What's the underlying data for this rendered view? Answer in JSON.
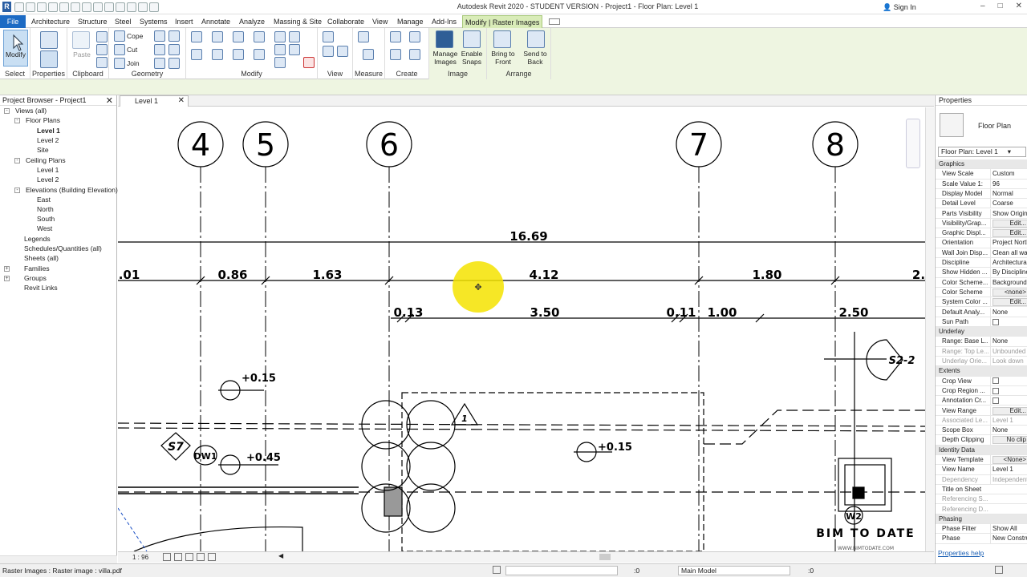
{
  "titlebar": {
    "title": "Autodesk Revit 2020 - STUDENT VERSION - Project1 - Floor Plan: Level 1",
    "signin": "Sign In"
  },
  "tabs": [
    "File",
    "Architecture",
    "Structure",
    "Steel",
    "Systems",
    "Insert",
    "Annotate",
    "Analyze",
    "Massing & Site",
    "Collaborate",
    "View",
    "Manage",
    "Add-Ins",
    "Modify | Raster Images"
  ],
  "ribbon": {
    "modify_label": "Modify",
    "paste_label": "Paste",
    "cope_label": "Cope",
    "cut_label": "Cut",
    "join_label": "Join",
    "manage_images_label": "Manage Images",
    "enable_snaps_label": "Enable Snaps",
    "bring_front_label": "Bring to Front",
    "send_back_label": "Send to Back",
    "panels": [
      "Select",
      "Properties",
      "Clipboard",
      "Geometry",
      "Modify",
      "View",
      "Measure",
      "Create",
      "Image",
      "Arrange"
    ]
  },
  "browser": {
    "title": "Project Browser - Project1",
    "items": [
      "Views (all)",
      "Floor Plans",
      "Level 1",
      "Level 2",
      "Site",
      "Ceiling Plans",
      "Level 1",
      "Level 2",
      "Elevations (Building Elevation)",
      "East",
      "North",
      "South",
      "West",
      "Legends",
      "Schedules/Quantities (all)",
      "Sheets (all)",
      "Families",
      "Groups",
      "Revit Links"
    ]
  },
  "view": {
    "tab_label": "Level 1",
    "scale_label": "1 : 96",
    "grids": [
      "4",
      "5",
      "6",
      "7",
      "8"
    ],
    "dimensions": [
      "16.69",
      ".01",
      "0.86",
      "1.63",
      "4.12",
      "1.80",
      "2.",
      "0.13",
      "3.50",
      "0.11",
      "1.00",
      "2.50"
    ],
    "levels": [
      "+0.15",
      "+0.45",
      "+0.15"
    ],
    "tags": [
      "S7",
      "DW1",
      "S2-2",
      "W2",
      "1"
    ],
    "watermark": "BIM TO DATE",
    "watermark_url": "WWW.BIMTODATE.COM"
  },
  "properties": {
    "title": "Properties",
    "type_label": "Floor Plan",
    "selector": "Floor Plan: Level 1",
    "rows": [
      {
        "g": "Graphics"
      },
      {
        "k": "View Scale",
        "v": "Custom"
      },
      {
        "k": "Scale Value    1:",
        "v": "96"
      },
      {
        "k": "Display Model",
        "v": "Normal"
      },
      {
        "k": "Detail Level",
        "v": "Coarse"
      },
      {
        "k": "Parts Visibility",
        "v": "Show Original"
      },
      {
        "k": "Visibility/Grap...",
        "v": "Edit...",
        "btn": true
      },
      {
        "k": "Graphic Displ...",
        "v": "Edit...",
        "btn": true
      },
      {
        "k": "Orientation",
        "v": "Project North"
      },
      {
        "k": "Wall Join Disp...",
        "v": "Clean all wall"
      },
      {
        "k": "Discipline",
        "v": "Architectural"
      },
      {
        "k": "Show Hidden ...",
        "v": "By Discipline"
      },
      {
        "k": "Color Scheme...",
        "v": "Background"
      },
      {
        "k": "Color Scheme",
        "v": "<none>",
        "btn": true
      },
      {
        "k": "System Color ...",
        "v": "Edit...",
        "btn": true
      },
      {
        "k": "Default Analy...",
        "v": "None"
      },
      {
        "k": "Sun Path",
        "chk": true
      },
      {
        "g": "Underlay"
      },
      {
        "k": "Range: Base L...",
        "v": "None"
      },
      {
        "k": "Range: Top Le...",
        "v": "Unbounded",
        "dim": true
      },
      {
        "k": "Underlay Orie...",
        "v": "Look down",
        "dim": true
      },
      {
        "g": "Extents"
      },
      {
        "k": "Crop View",
        "chk": true
      },
      {
        "k": "Crop Region ...",
        "chk": true
      },
      {
        "k": "Annotation Cr...",
        "chk": true
      },
      {
        "k": "View Range",
        "v": "Edit...",
        "btn": true
      },
      {
        "k": "Associated Le...",
        "v": "Level 1",
        "dim": true
      },
      {
        "k": "Scope Box",
        "v": "None"
      },
      {
        "k": "Depth Clipping",
        "v": "No clip",
        "btn": true
      },
      {
        "g": "Identity Data"
      },
      {
        "k": "View Template",
        "v": "<None>",
        "btn": true
      },
      {
        "k": "View Name",
        "v": "Level 1"
      },
      {
        "k": "Dependency",
        "v": "Independent",
        "dim": true
      },
      {
        "k": "Title on Sheet",
        "v": ""
      },
      {
        "k": "Referencing S...",
        "v": "",
        "dim": true
      },
      {
        "k": "Referencing D...",
        "v": "",
        "dim": true
      },
      {
        "g": "Phasing"
      },
      {
        "k": "Phase Filter",
        "v": "Show All"
      },
      {
        "k": "Phase",
        "v": "New Construction"
      }
    ],
    "help": "Properties help"
  },
  "status": {
    "text": "Raster Images : Raster image : villa.pdf",
    "zero": ":0",
    "model": "Main Model",
    "last": ":0"
  }
}
